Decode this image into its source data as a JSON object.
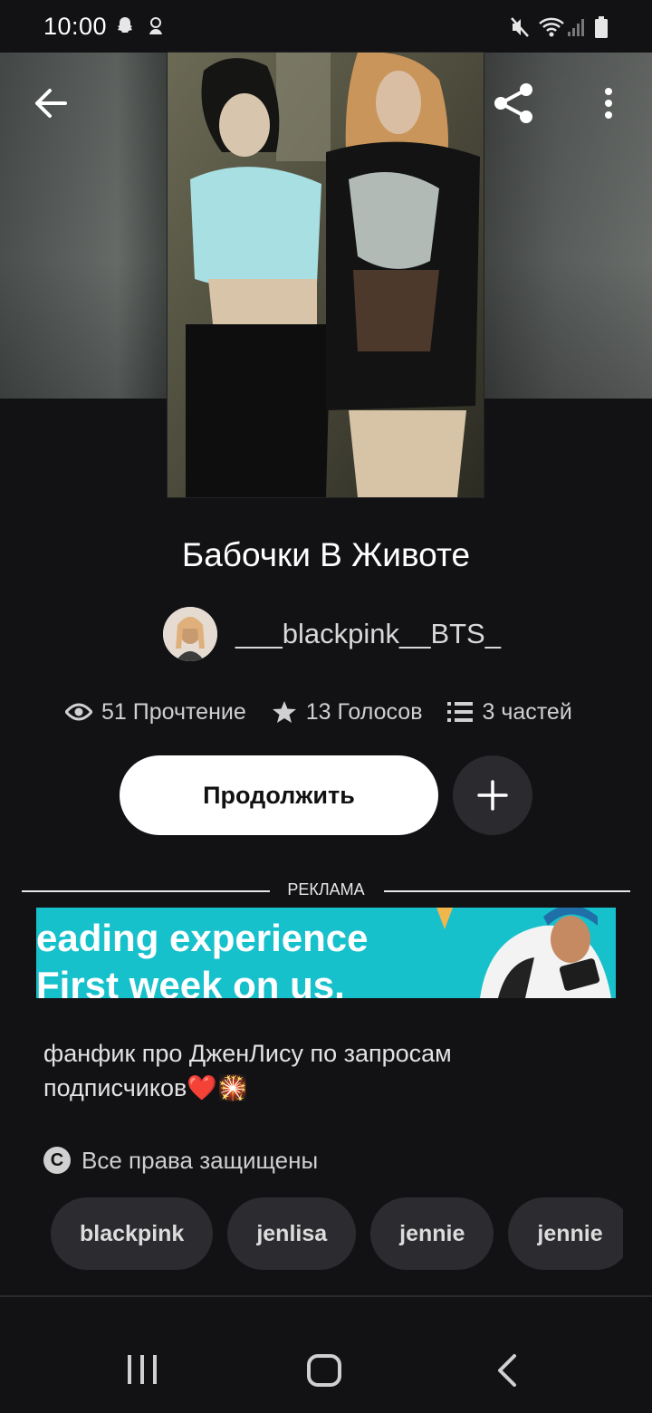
{
  "status_bar": {
    "time": "10:00"
  },
  "story": {
    "title": "Бабочки В Животе",
    "author": "___blackpink__BTS_",
    "stats": {
      "reads": "51 Прочтение",
      "votes": "13 Голосов",
      "parts": "3 частей"
    },
    "continue_label": "Продолжить",
    "description": "фанфик про ДженЛису по запросам подписчиков❤️🎇",
    "rights": "Все права защищены",
    "tags": [
      "blackpink",
      "jenlisa",
      "jennie",
      "jennie"
    ]
  },
  "ad": {
    "label": "РЕКЛАМА",
    "line1": "eading experience",
    "line2": "First week on us."
  },
  "icons": {
    "back": "arrow-left-icon",
    "share": "share-icon",
    "more": "more-vert-icon",
    "views": "eye-icon",
    "votes": "star-icon",
    "parts": "list-icon",
    "add": "plus-icon",
    "copyright": "copyright-icon"
  },
  "colors": {
    "background": "#121114",
    "button_primary": "#ffffff",
    "chip": "#2c2b2f",
    "ad_bg": "#17c1cc"
  }
}
